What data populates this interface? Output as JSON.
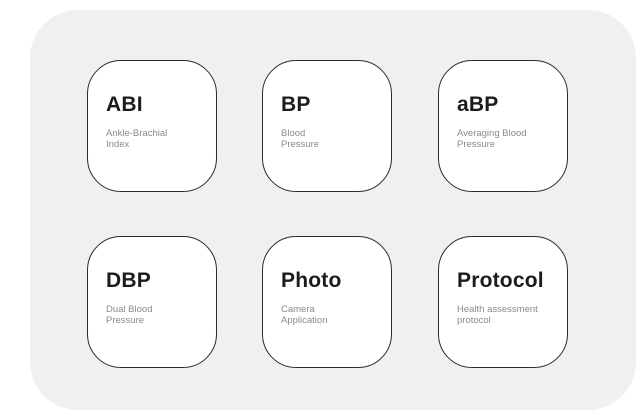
{
  "tiles": [
    {
      "id": "abi",
      "title": "ABI",
      "subtitle": "Ankle-Brachial\nIndex"
    },
    {
      "id": "bp",
      "title": "BP",
      "subtitle": "Blood\nPressure"
    },
    {
      "id": "abp",
      "title": "aBP",
      "subtitle": "Averaging Blood\nPressure"
    },
    {
      "id": "dbp",
      "title": "DBP",
      "subtitle": "Dual Blood\nPressure"
    },
    {
      "id": "photo",
      "title": "Photo",
      "subtitle": "Camera\nApplication"
    },
    {
      "id": "protocol",
      "title": "Protocol",
      "subtitle": "Health assessment\nprotocol"
    }
  ],
  "colors": {
    "panel_background": "#f0f0f0",
    "tile_background": "#ffffff",
    "tile_border": "#2b2b2b",
    "title_text": "#1c1c1c",
    "subtitle_text": "#8a8a8a"
  }
}
